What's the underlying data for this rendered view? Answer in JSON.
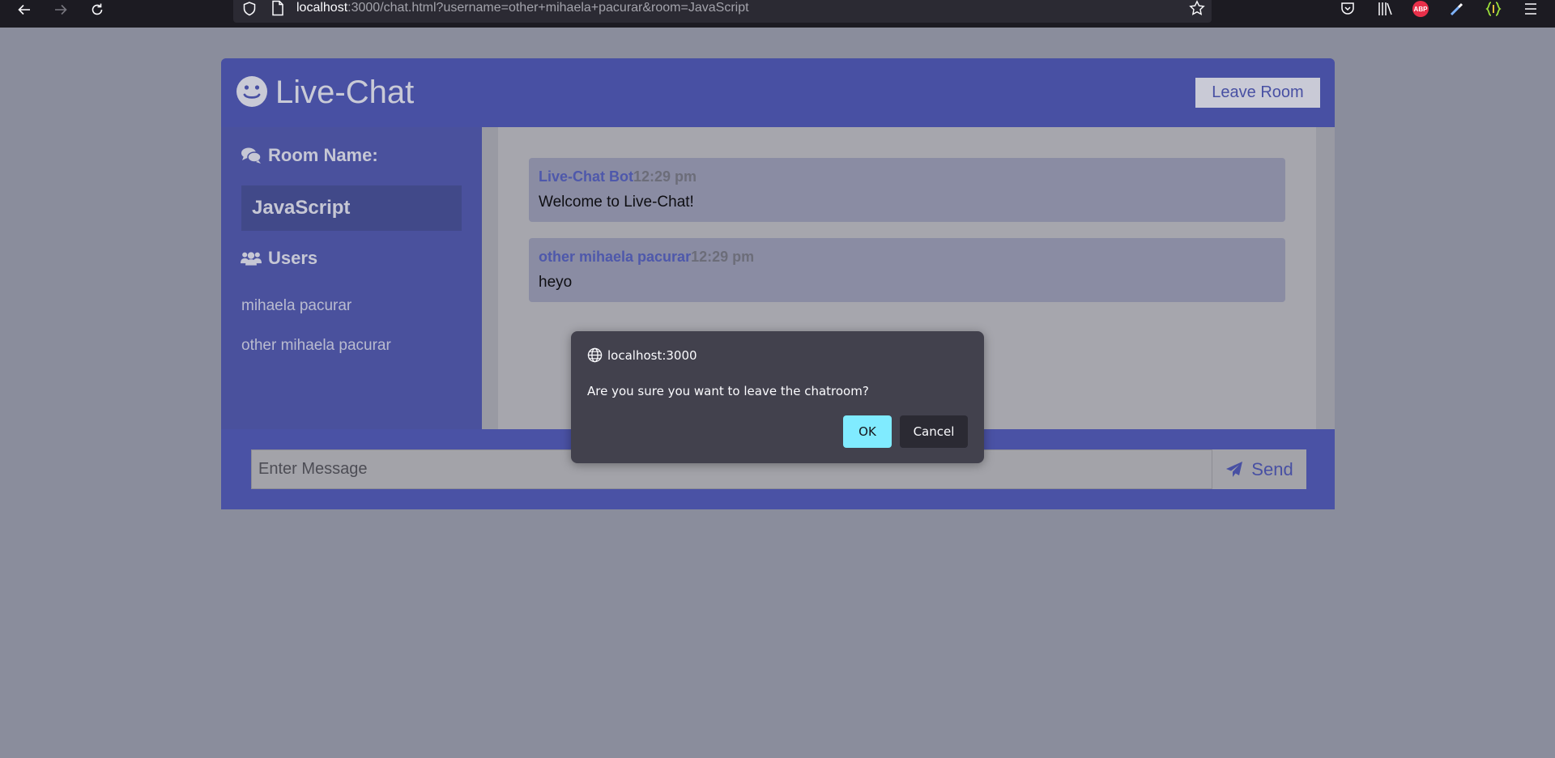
{
  "browser": {
    "url_host": "localhost",
    "url_rest": ":3000/chat.html?username=other+mihaela+pacurar&room=JavaScript",
    "abp_label": "ABP",
    "icons": [
      "back-arrow-icon",
      "forward-arrow-icon",
      "reload-icon",
      "shield-icon",
      "page-icon",
      "bookmark-star-icon",
      "pocket-icon",
      "library-icon",
      "adblock-icon",
      "eyedropper-icon",
      "extension-icon",
      "menu-icon"
    ]
  },
  "header": {
    "title": "Live-Chat",
    "leave_label": "Leave Room"
  },
  "sidebar": {
    "room_heading": "Room Name:",
    "room_name": "JavaScript",
    "users_heading": "Users",
    "users": [
      "mihaela pacurar",
      "other mihaela pacurar"
    ]
  },
  "messages": [
    {
      "user": "Live-Chat Bot",
      "time": "12:29 pm",
      "text": "Welcome to Live-Chat!"
    },
    {
      "user": "other mihaela pacurar",
      "time": "12:29 pm",
      "text": "heyo"
    }
  ],
  "footer": {
    "input_placeholder": "Enter Message",
    "send_label": "Send"
  },
  "dialog": {
    "origin": "localhost:3000",
    "message": "Are you sure you want to leave the chatroom?",
    "ok_label": "OK",
    "cancel_label": "Cancel"
  },
  "colors": {
    "header_blue": "#4850a3",
    "dialog_bg": "#42414d",
    "ok_accent": "#80ebff"
  }
}
